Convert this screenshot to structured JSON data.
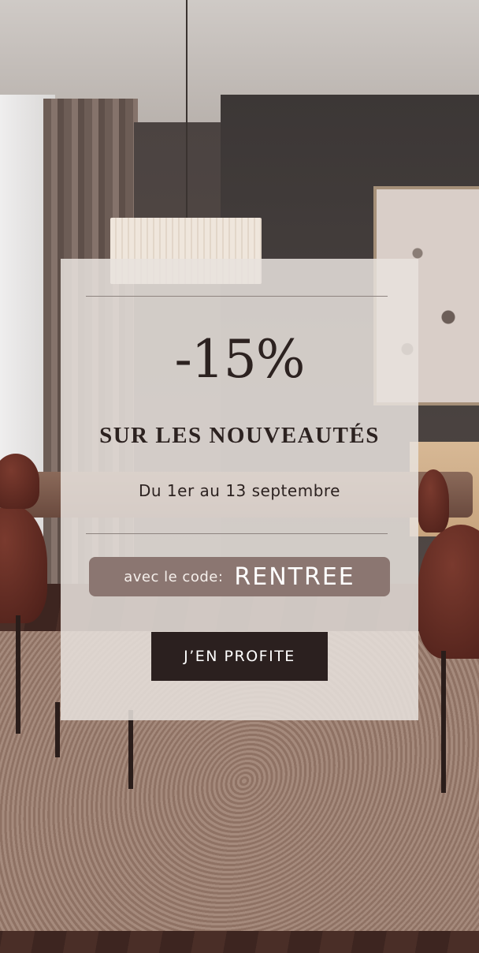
{
  "promo": {
    "discount": "-15%",
    "headline": "SUR LES NOUVEAUTÉS",
    "dates": "Du 1er au 13 septembre",
    "code_label": "avec le code:",
    "code_value": "RENTREE",
    "cta_label": "J’EN PROFITE"
  },
  "colors": {
    "card_bg": "#e8e2dd",
    "text_dark": "#2c2220",
    "code_bg": "#8b7671",
    "cta_bg": "#2b201f"
  }
}
